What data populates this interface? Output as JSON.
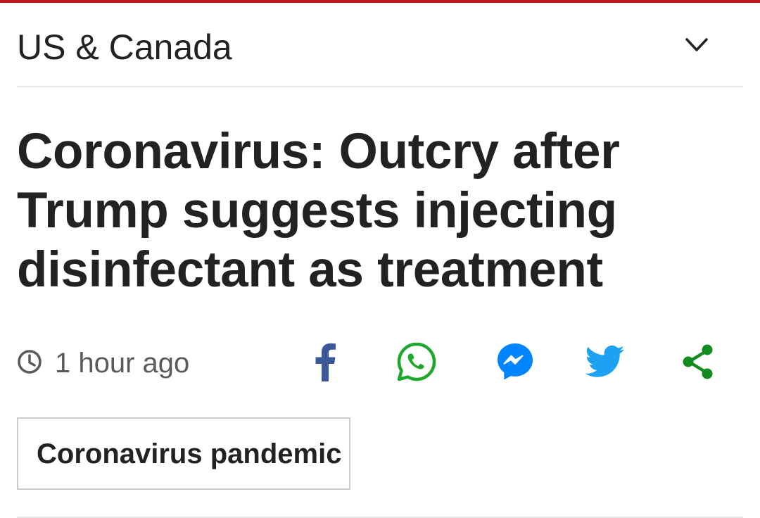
{
  "section": {
    "title": "US & Canada",
    "expand_icon": "chevron-down-icon"
  },
  "article": {
    "headline_lines": [
      "Coronavirus: Outcry after",
      "Trump suggests injecting",
      "disinfectant as treatment"
    ],
    "timestamp": "1 hour ago",
    "timestamp_icon": "clock-icon"
  },
  "share": {
    "buttons": [
      {
        "icon": "facebook-icon",
        "color": "#3b5998"
      },
      {
        "icon": "whatsapp-icon",
        "color": "#1ea82b"
      },
      {
        "icon": "messenger-icon",
        "color": "#0084ff"
      },
      {
        "icon": "twitter-icon",
        "color": "#1da1f2"
      },
      {
        "icon": "share-icon",
        "color": "#138b1f"
      }
    ]
  },
  "topic_tag": {
    "label": "Coronavirus pandemic"
  },
  "colors": {
    "brand_red": "#bb1919",
    "text_primary": "#222222",
    "text_secondary": "#5a5a5a",
    "divider": "#e6e6e6"
  }
}
